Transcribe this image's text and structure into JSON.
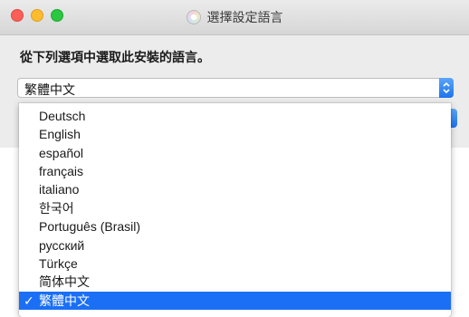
{
  "window": {
    "title": "選擇設定語言",
    "instruction": "從下列選項中選取此安裝的語言。",
    "selected_language": "繁體中文"
  },
  "dropdown": {
    "options": [
      {
        "label": "Deutsch"
      },
      {
        "label": "English"
      },
      {
        "label": "español"
      },
      {
        "label": "français"
      },
      {
        "label": "italiano"
      },
      {
        "label": "한국어"
      },
      {
        "label": "Português (Brasil)"
      },
      {
        "label": "русский"
      },
      {
        "label": "Türkçe"
      },
      {
        "label": "简体中文"
      },
      {
        "label": "繁體中文",
        "selected": true
      }
    ],
    "check_mark": "✓"
  },
  "colors": {
    "selection": "#1b6ff5",
    "close": "#fc5f57",
    "minimize": "#fdbc2e",
    "maximize": "#29c840"
  },
  "icons": [
    "app-icon",
    "chevron-updown-icon",
    "checkmark-icon"
  ]
}
